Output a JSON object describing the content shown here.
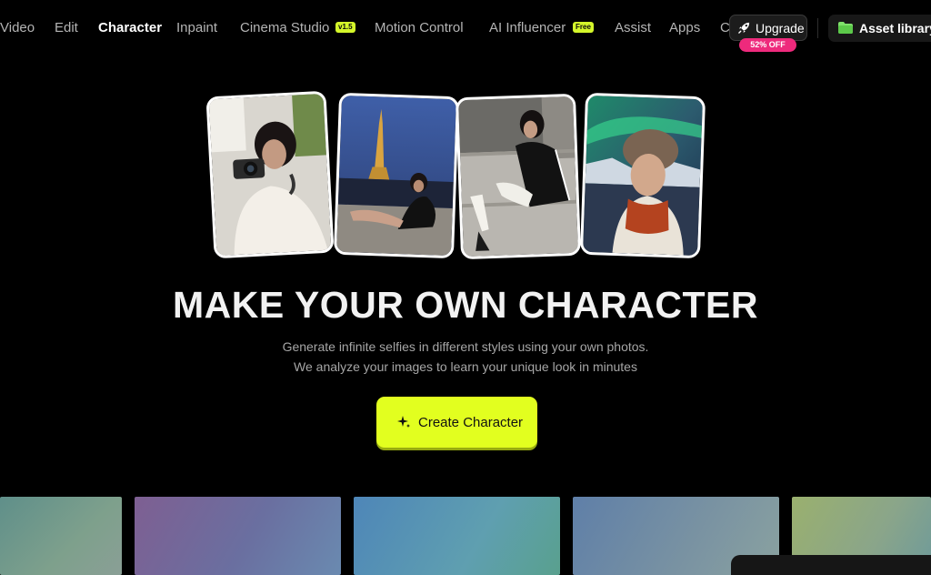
{
  "nav": {
    "items": [
      {
        "id": "video",
        "label": "Video"
      },
      {
        "id": "edit",
        "label": "Edit"
      },
      {
        "id": "character",
        "label": "Character",
        "active": true
      },
      {
        "id": "inpaint",
        "label": "Inpaint"
      },
      {
        "id": "cinema-studio",
        "label": "Cinema Studio",
        "badge": "v1.5"
      },
      {
        "id": "motion-control",
        "label": "Motion Control"
      },
      {
        "id": "ai-influencer",
        "label": "AI Influencer",
        "badge": "Free"
      },
      {
        "id": "assist",
        "label": "Assist"
      },
      {
        "id": "apps",
        "label": "Apps"
      },
      {
        "id": "more",
        "label": "C"
      }
    ],
    "upgrade": {
      "label": "Upgrade",
      "icon": "rocket-icon",
      "discount": "52% OFF"
    },
    "asset_library": {
      "label": "Asset library",
      "icon": "folder-icon"
    }
  },
  "hero": {
    "cards": [
      {
        "subject": "woman holding camera",
        "rotation": -3
      },
      {
        "subject": "woman posing near Eiffel Tower at night",
        "rotation": 2
      },
      {
        "subject": "woman sitting on steps in tracksuit",
        "rotation": -2
      },
      {
        "subject": "woman in fur hat under northern lights",
        "rotation": 2
      }
    ],
    "headline": "MAKE YOUR OWN CHARACTER",
    "subtitle_line1": "Generate infinite selfies in different styles using your own photos.",
    "subtitle_line2": "We analyze your images to learn your unique look in minutes",
    "cta": {
      "label": "Create Character",
      "icon": "sparkle-icon"
    }
  },
  "gallery": {
    "tiles": [
      {
        "id": "tile-1"
      },
      {
        "id": "tile-2"
      },
      {
        "id": "tile-3"
      },
      {
        "id": "tile-4"
      },
      {
        "id": "tile-5"
      }
    ]
  },
  "colors": {
    "background": "#000000",
    "accent": "#e2ff1f",
    "badge": "#d4f62a",
    "discount": "#ee2a7c",
    "nav_text": "#b4b4b4"
  }
}
